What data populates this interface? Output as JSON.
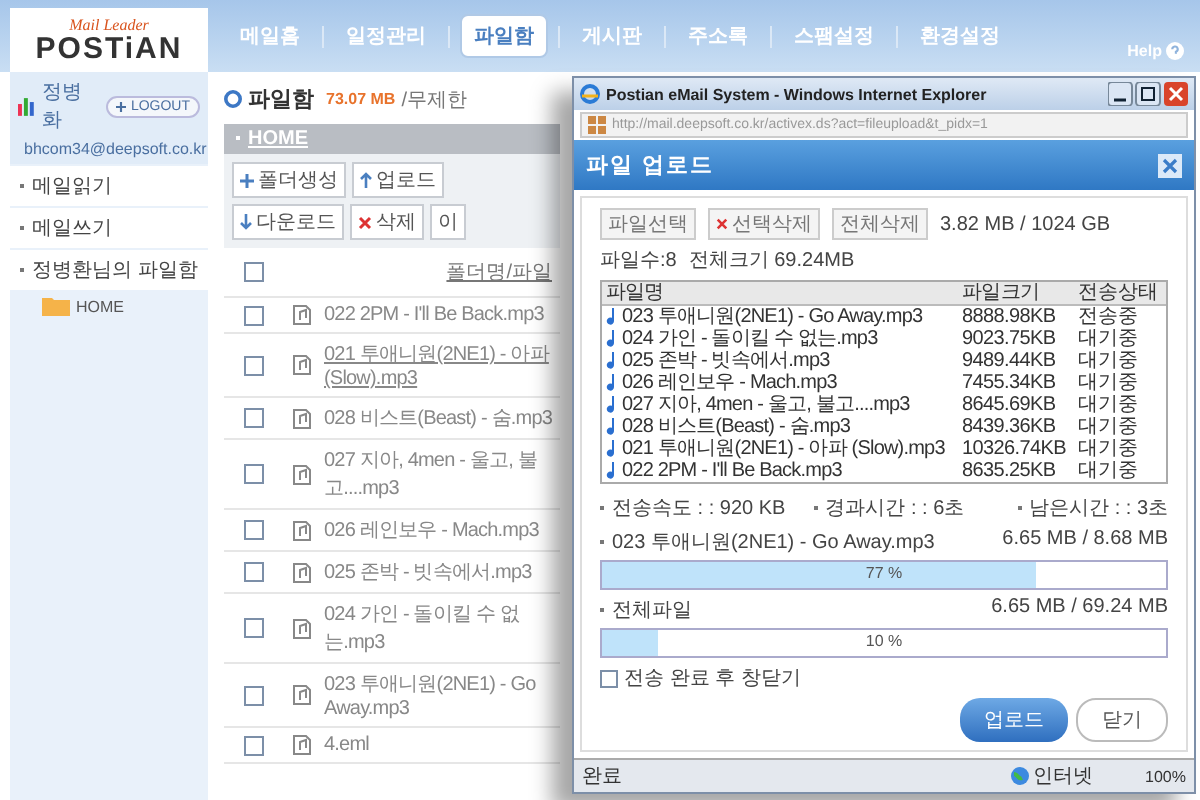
{
  "header": {
    "tagline": "Mail Leader",
    "logo": "POSTiAN",
    "help": "Help",
    "nav": [
      {
        "label": "메일홈",
        "selected": false
      },
      {
        "label": "일정관리",
        "selected": false
      },
      {
        "label": "파일함",
        "selected": true
      },
      {
        "label": "게시판",
        "selected": false
      },
      {
        "label": "주소록",
        "selected": false
      },
      {
        "label": "스팸설정",
        "selected": false
      },
      {
        "label": "환경설정",
        "selected": false
      }
    ]
  },
  "sidebar": {
    "user": "정병화",
    "logout": "LOGOUT",
    "email": "bhcom34@deepsoft.co.kr",
    "menu": [
      "메일읽기",
      "메일쓰기",
      "정병환님의 파일함"
    ],
    "tree": [
      {
        "label": "HOME"
      }
    ]
  },
  "main": {
    "title": "파일함",
    "usage": "73.07 MB",
    "quota": "/무제한",
    "path": "HOME",
    "toolbar": [
      {
        "label": "폴더생성",
        "kind": "new"
      },
      {
        "label": "업로드",
        "kind": "up"
      },
      {
        "label": "다운로드",
        "kind": "down"
      },
      {
        "label": "삭제",
        "kind": "delete"
      },
      {
        "label": "이",
        "kind": "plain"
      }
    ],
    "all_checked": false,
    "column": "폴더명/파일",
    "files": [
      {
        "name": "022 2PM - I'll Be Back.mp3",
        "checked": false,
        "hovered": false
      },
      {
        "name": "021 투애니원(2NE1) - 아파 (Slow).mp3",
        "checked": false,
        "hovered": true
      },
      {
        "name": "028 비스트(Beast) - 숨.mp3",
        "checked": false,
        "hovered": false
      },
      {
        "name": "027 지아, 4men - 울고, 불고....mp3",
        "checked": false,
        "hovered": false
      },
      {
        "name": "026 레인보우 - Mach.mp3",
        "checked": false,
        "hovered": false
      },
      {
        "name": "025 존박 - 빗속에서.mp3",
        "checked": false,
        "hovered": false
      },
      {
        "name": "024 가인 - 돌이킬 수 없는.mp3",
        "checked": false,
        "hovered": false
      },
      {
        "name": "023 투애니원(2NE1) - Go Away.mp3",
        "checked": false,
        "hovered": false
      },
      {
        "name": "4.eml",
        "checked": false,
        "hovered": false
      }
    ]
  },
  "popup": {
    "title": "Postian eMail System - Windows Internet Explorer",
    "address": "http://mail.deepsoft.co.kr/activex.ds?act=fileupload&t_pidx=1",
    "dialog_title": "파일 업로드",
    "buttons": [
      {
        "label": "파일선택",
        "kind": "plain"
      },
      {
        "label": "선택삭제",
        "kind": "delete"
      },
      {
        "label": "전체삭제",
        "kind": "plain"
      }
    ],
    "capacity": "3.82 MB / 1024 GB",
    "file_count": "파일수:8",
    "total_size": "전체크기 69.24MB",
    "columns": [
      "파일명",
      "파일크기",
      "전송상태"
    ],
    "rows": [
      {
        "name": "023 투애니원(2NE1) - Go Away.mp3",
        "size": "8888.98KB",
        "status": "전송중"
      },
      {
        "name": "024 가인 - 돌이킬 수 없는.mp3",
        "size": "9023.75KB",
        "status": "대기중"
      },
      {
        "name": "025 존박 - 빗속에서.mp3",
        "size": "9489.44KB",
        "status": "대기중"
      },
      {
        "name": "026 레인보우 - Mach.mp3",
        "size": "7455.34KB",
        "status": "대기중"
      },
      {
        "name": "027 지아, 4men - 울고, 불고....mp3",
        "size": "8645.69KB",
        "status": "대기중"
      },
      {
        "name": "028 비스트(Beast) - 숨.mp3",
        "size": "8439.36KB",
        "status": "대기중"
      },
      {
        "name": "021 투애니원(2NE1) - 아파 (Slow).mp3",
        "size": "10326.74KB",
        "status": "대기중"
      },
      {
        "name": "022 2PM - I'll Be Back.mp3",
        "size": "8635.25KB",
        "status": "대기중"
      }
    ],
    "stats": [
      "전송속도 : : 920 KB",
      "경과시간 : : 6초",
      "남은시간 : : 3초"
    ],
    "current": {
      "name": "023 투애니원(2NE1) - Go Away.mp3",
      "amount": "6.65 MB / 8.68 MB",
      "level": 0.77,
      "percent": "77 %"
    },
    "overall": {
      "name": "전체파일",
      "amount": "6.65 MB / 69.24 MB",
      "level": 0.1,
      "percent": "10 %"
    },
    "close_after": {
      "label": "전송 완료 후 창닫기",
      "checked": false
    },
    "upload": "업로드",
    "close": "닫기",
    "status": "완료",
    "zone": "인터넷",
    "zoom": "100%"
  }
}
